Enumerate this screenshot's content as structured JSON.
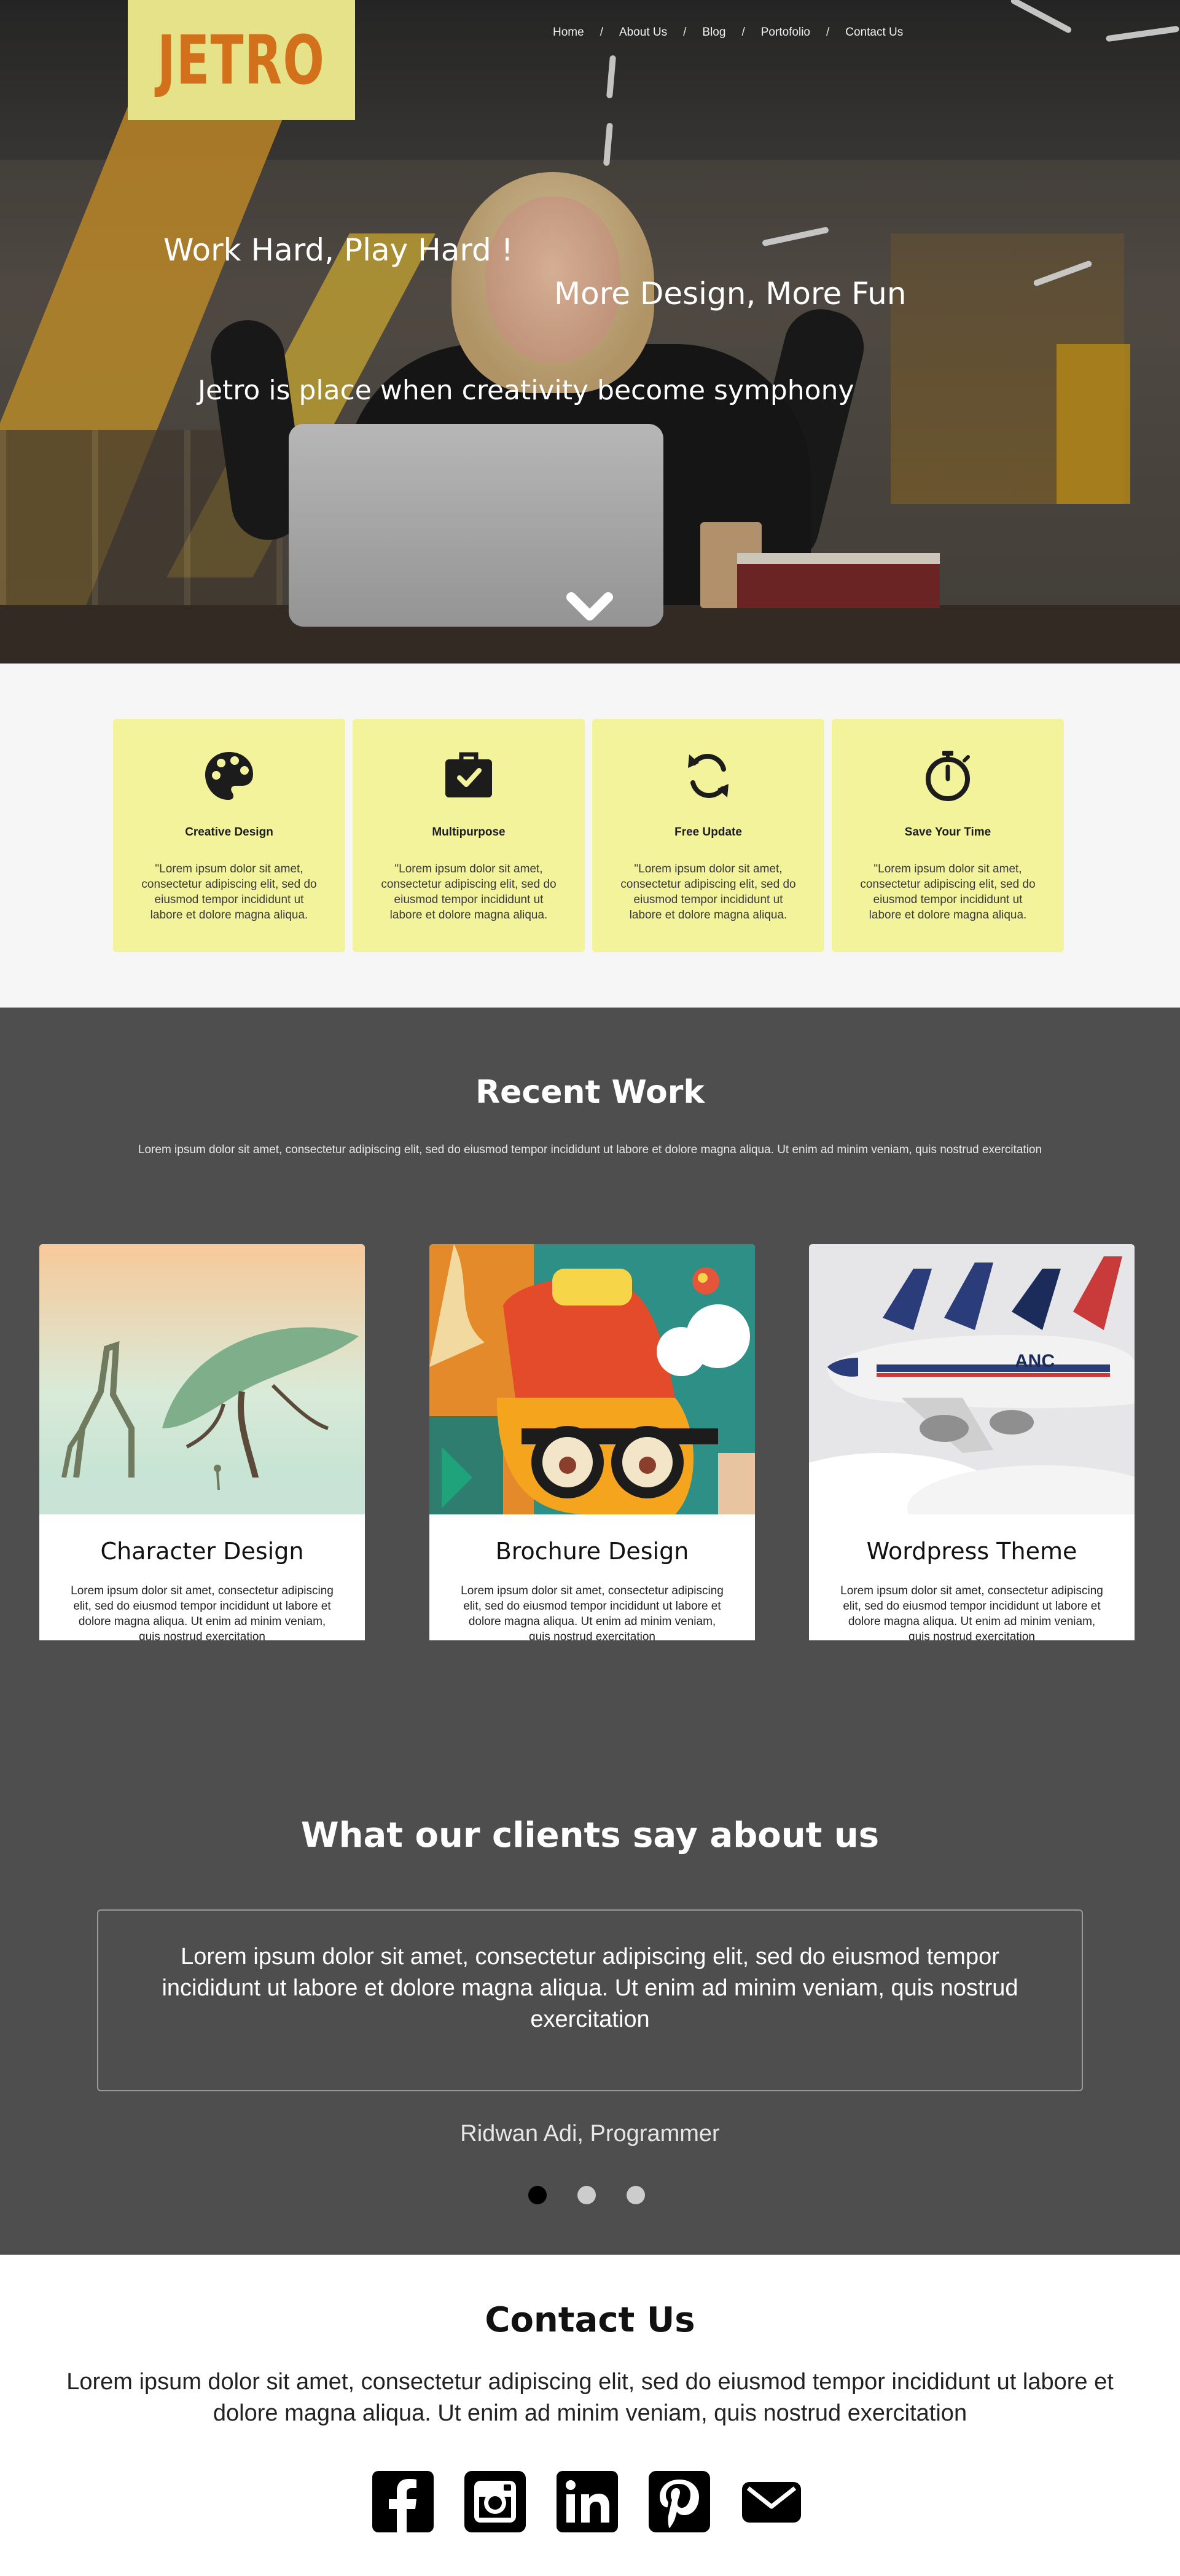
{
  "brand": {
    "logo_text": "JETRO",
    "logo_color": "#d2701c",
    "logo_bg": "#e6e289"
  },
  "nav": {
    "items": [
      "Home",
      "About Us",
      "Blog",
      "Portofolio",
      "Contact Us"
    ],
    "separator": "/"
  },
  "hero": {
    "headline_1": "Work Hard, Play Hard !",
    "headline_2": "More Design, More Fun",
    "tagline": "Jetro is place when creativity become symphony",
    "scroll_icon": "chevron-down-icon"
  },
  "features": [
    {
      "icon": "palette-icon",
      "title": "Creative Design",
      "text": "\"Lorem ipsum dolor sit amet, consectetur adipiscing elit, sed do eiusmod tempor incididunt ut labore et dolore magna aliqua."
    },
    {
      "icon": "briefcase-check-icon",
      "title": "Multipurpose",
      "text": "\"Lorem ipsum dolor sit amet, consectetur adipiscing elit, sed do eiusmod tempor incididunt ut labore et dolore magna aliqua."
    },
    {
      "icon": "sync-icon",
      "title": "Free Update",
      "text": "\"Lorem ipsum dolor sit amet, consectetur adipiscing elit, sed do eiusmod tempor incididunt ut labore et dolore magna aliqua."
    },
    {
      "icon": "stopwatch-icon",
      "title": "Save Your Time",
      "text": "\"Lorem ipsum dolor sit amet, consectetur adipiscing elit, sed do eiusmod tempor incididunt ut labore et dolore magna aliqua."
    }
  ],
  "feature_card_bg": "#f3f39c",
  "work": {
    "title": "Recent Work",
    "subtitle": "Lorem ipsum dolor sit amet, consectetur adipiscing elit, sed do eiusmod tempor incididunt ut labore et dolore magna aliqua. Ut enim ad minim veniam, quis nostrud exercitation",
    "cards": [
      {
        "title": "Character Design",
        "text": "Lorem ipsum dolor sit amet, consectetur adipiscing elit, sed do eiusmod tempor incididunt ut labore et dolore magna aliqua. Ut enim ad minim veniam, quis nostrud exercitation"
      },
      {
        "title": "Brochure Design",
        "text": "Lorem ipsum dolor sit amet, consectetur adipiscing elit, sed do eiusmod tempor incididunt ut labore et dolore magna aliqua. Ut enim ad minim veniam, quis nostrud exercitation"
      },
      {
        "title": "Wordpress Theme",
        "text": "Lorem ipsum dolor sit amet, consectetur adipiscing elit, sed do eiusmod tempor incididunt ut labore et dolore magna aliqua. Ut enim ad minim veniam, quis nostrud exercitation"
      }
    ]
  },
  "section_bg_dark": "#4e4e4e",
  "testimonial": {
    "title": "What our clients say about us",
    "quote": "Lorem ipsum dolor sit amet, consectetur adipiscing elit, sed do eiusmod tempor incididunt ut labore et dolore magna aliqua. Ut enim ad minim veniam, quis nostrud exercitation",
    "author": "Ridwan Adi, Programmer",
    "slides": 3,
    "active_slide": 1
  },
  "contact": {
    "title": "Contact Us",
    "text": "Lorem ipsum dolor sit amet, consectetur adipiscing elit, sed do eiusmod tempor incididunt ut labore et dolore magna aliqua. Ut enim ad minim veniam, quis nostrud exercitation",
    "socials": [
      "facebook-icon",
      "instagram-icon",
      "linkedin-icon",
      "pinterest-icon",
      "email-icon"
    ]
  }
}
